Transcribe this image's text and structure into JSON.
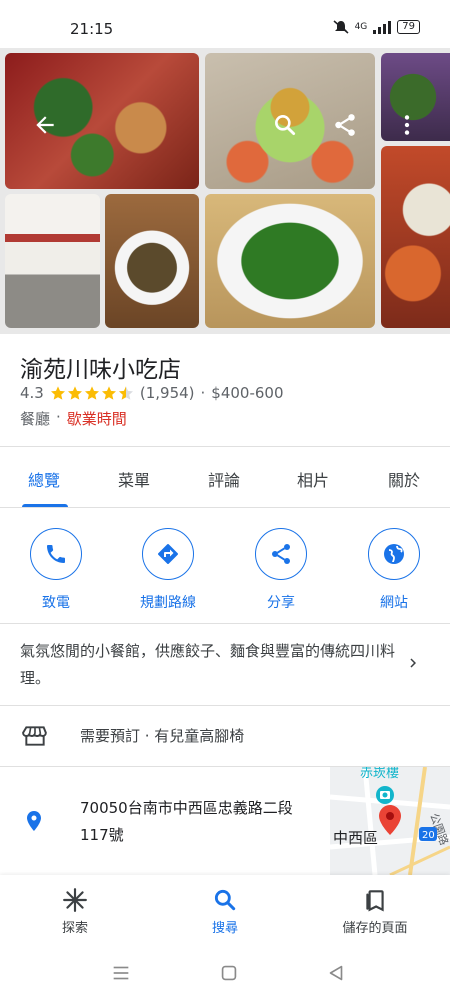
{
  "status_bar": {
    "time": "21:15",
    "network": "4G",
    "battery": "79"
  },
  "place": {
    "name": "渝苑川味小吃店",
    "rating": "4.3",
    "stars": 4.5,
    "review_count": "(1,954)",
    "separator": "·",
    "price": "$400-600",
    "category": "餐廳",
    "hours_label": "歇業時間"
  },
  "tabs": {
    "overview": "總覽",
    "menu": "菜單",
    "reviews": "評論",
    "photos": "相片",
    "about": "關於"
  },
  "actions": {
    "call": "致電",
    "directions": "規劃路線",
    "share": "分享",
    "website": "網站"
  },
  "description": "氣氛悠閒的小餐館，供應餃子、麵食與豐富的傳統四川料理。",
  "amenities": "需要預訂 · 有兒童高腳椅",
  "address": "70050台南市中西區忠義路二段117號",
  "map": {
    "label_top": "赤崁樓",
    "label_district": "中西區",
    "label_road": "公園路",
    "road_number": "20"
  },
  "bottom_nav": {
    "explore": "探索",
    "search": "搜尋",
    "saved": "儲存的頁面"
  },
  "colors": {
    "accent": "#1a73e8",
    "star": "#fbbc04",
    "hours": "#d93025",
    "map_pin": "#ea4335"
  }
}
